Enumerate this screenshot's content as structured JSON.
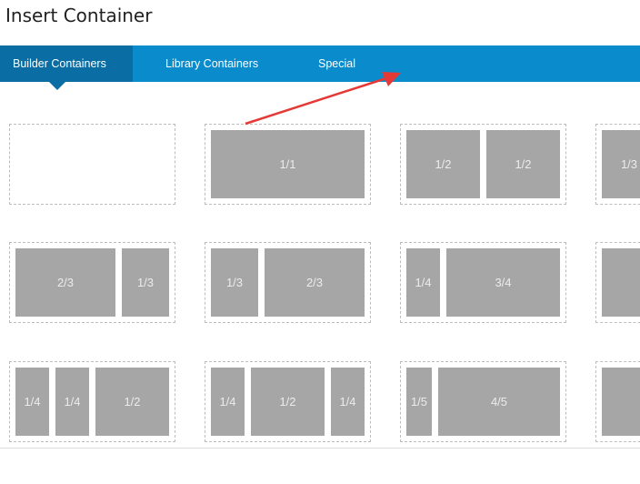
{
  "title": "Insert Container",
  "tabs": [
    {
      "label": "Builder Containers",
      "active": true
    },
    {
      "label": "Library Containers",
      "active": false
    },
    {
      "label": "Special",
      "active": false
    }
  ],
  "layouts": [
    {
      "columns": []
    },
    {
      "columns": [
        "1/1"
      ]
    },
    {
      "columns": [
        "1/2",
        "1/2"
      ]
    },
    {
      "columns": [
        "1/3"
      ]
    },
    {
      "columns": [
        "2/3",
        "1/3"
      ]
    },
    {
      "columns": [
        "1/3",
        "2/3"
      ]
    },
    {
      "columns": [
        "1/4",
        "3/4"
      ]
    },
    {
      "columns": [
        ""
      ]
    },
    {
      "columns": [
        "1/4",
        "1/4",
        "1/2"
      ]
    },
    {
      "columns": [
        "1/4",
        "1/2",
        "1/4"
      ]
    },
    {
      "columns": [
        "1/5",
        "4/5"
      ]
    },
    {
      "columns": [
        ""
      ]
    }
  ],
  "colors": {
    "tabbar": "#0a8bcb",
    "tab_active": "#0a6ea4",
    "column": "#a6a6a6",
    "arrow": "#e53935"
  }
}
